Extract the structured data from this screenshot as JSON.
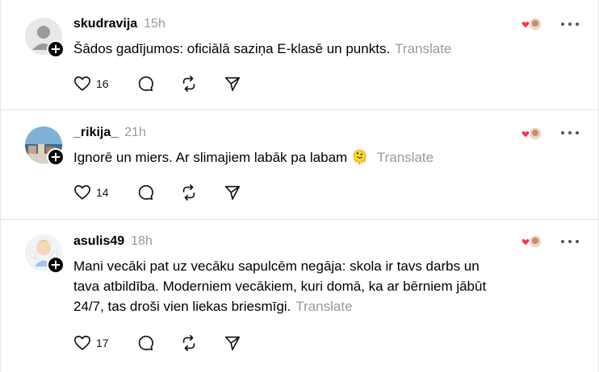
{
  "posts": [
    {
      "username": "skudravija",
      "time": "15h",
      "text": "Šādos gadījumos: oficiālā saziņa E-klasē un punkts.",
      "emoji": "",
      "translate": "Translate",
      "likes": "16"
    },
    {
      "username": "_rikija_",
      "time": "21h",
      "text": "Ignorē un miers. Ar slimajiem labāk pa labam",
      "emoji": "🫠",
      "translate": "Translate",
      "likes": "14"
    },
    {
      "username": "asulis49",
      "time": "18h",
      "text": "Mani vecāki pat uz vecāku sapulcēm negāja: skola ir tavs darbs un tava atbildība. Moderniem vecākiem, kuri domā, ka ar bērniem jābūt 24/7, tas droši vien liekas briesmīgi.",
      "emoji": "",
      "translate": "Translate",
      "likes": "17"
    }
  ],
  "icons": {
    "like": "heart-icon",
    "reply": "comment-icon",
    "repost": "repost-icon",
    "share": "send-icon",
    "more": "more-icon",
    "follow": "plus-icon"
  },
  "colors": {
    "text": "#000000",
    "muted": "#999999",
    "divider": "#e3e3e3",
    "heart": "#ff2d55"
  }
}
